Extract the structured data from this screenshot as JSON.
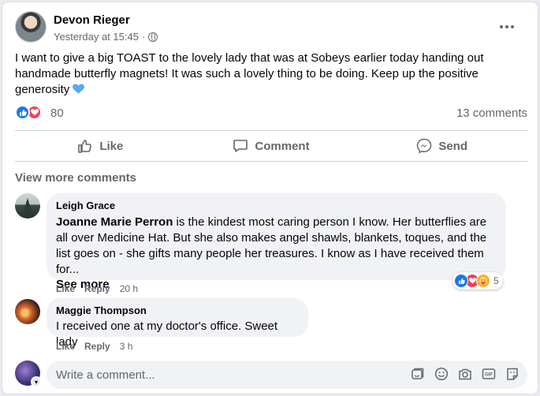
{
  "post": {
    "author": "Devon Rieger",
    "timestamp": "Yesterday at 15:45",
    "separator": "·",
    "audience_icon": "globe-icon",
    "text": "I want to give a big TOAST to the lovely lady that was at Sobeys earlier today handing out handmade butterfly magnets! It was such a lovely thing to be doing. Keep up the positive generosity",
    "emoji": "blue-heart-icon"
  },
  "reactions": {
    "icons": [
      "like-icon",
      "love-icon"
    ],
    "count": "80",
    "comments_count": "13 comments"
  },
  "actions": {
    "like": "Like",
    "comment": "Comment",
    "send": "Send"
  },
  "comments_section": {
    "view_more": "View more comments",
    "comments": [
      {
        "author": "Leigh Grace",
        "mention": "Joanne Marie Perron",
        "text_line1": " is the kindest most caring person I know. Her butterflies are all",
        "text_rest": "over Medicine Hat. But she also makes angel shawls, blankets, toques, and the list goes on - she gifts many people her treasures. I know as I have received them for...",
        "see_more": "See more",
        "like": "Like",
        "reply": "Reply",
        "time": "20 h",
        "reaction_icons": [
          "like-icon",
          "love-icon",
          "care-icon"
        ],
        "reaction_count": "5"
      },
      {
        "author": "Maggie Thompson",
        "text": "I received one at my doctor's office. Sweet lady",
        "like": "Like",
        "reply": "Reply",
        "time": "3 h"
      }
    ]
  },
  "composer": {
    "placeholder": "Write a comment...",
    "tools": [
      "sticker-icon",
      "emoji-icon",
      "camera-icon",
      "gif-icon",
      "avatar-sticker-icon"
    ]
  },
  "colors": {
    "accent": "#1877f2",
    "love": "#f33e58",
    "care": "#f7b125",
    "secondary_text": "#65676b",
    "bubble": "#f0f2f5"
  }
}
